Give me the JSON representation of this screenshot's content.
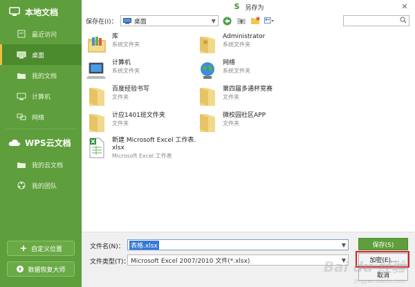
{
  "dialog": {
    "title": "另存为"
  },
  "sidebar": {
    "local_header": "本地文档",
    "local_items": [
      {
        "label": "最近访问",
        "icon": "clock-icon"
      },
      {
        "label": "桌面",
        "icon": "desktop-icon"
      },
      {
        "label": "我的文档",
        "icon": "folder-icon"
      },
      {
        "label": "计算机",
        "icon": "computer-icon"
      },
      {
        "label": "网络",
        "icon": "network-icon"
      }
    ],
    "cloud_header": "WPS云文档",
    "cloud_items": [
      {
        "label": "我的云文档",
        "icon": "cloud-folder-icon"
      },
      {
        "label": "我的团队",
        "icon": "team-icon"
      }
    ],
    "custom_location": "自定义位置",
    "recovery": "数据恢复大师"
  },
  "toolbar": {
    "save_in_label": "保存在(I)：",
    "location": "桌面"
  },
  "files": [
    {
      "name": "库",
      "type": "系统文件夹",
      "icon": "library-folder-icon"
    },
    {
      "name": "Administrator",
      "type": "系统文件夹",
      "icon": "user-folder-icon"
    },
    {
      "name": "计算机",
      "type": "系统文件夹",
      "icon": "computer-icon"
    },
    {
      "name": "网络",
      "type": "系统文件夹",
      "icon": "network-globe-icon"
    },
    {
      "name": "百度经验书写",
      "type": "文件夹",
      "icon": "folder-icon"
    },
    {
      "name": "第四届多通杯竞赛",
      "type": "文件夹",
      "icon": "folder-icon"
    },
    {
      "name": "计应1401班文件夹",
      "type": "文件夹",
      "icon": "folder-icon"
    },
    {
      "name": "微校园社区APP",
      "type": "文件夹",
      "icon": "folder-icon"
    },
    {
      "name": "新建 Microsoft Excel 工作表.",
      "name2": "xlsx",
      "type": "Microsoft Excel 工作表",
      "icon": "excel-file-icon"
    }
  ],
  "bottom": {
    "filename_label": "文件名(N)：",
    "filename_value": "表格.xlsx",
    "filetype_label": "文件类型(T)：",
    "filetype_value": "Microsoft Excel 2007/2010 文件(*.xlsx)",
    "save_label": "保存(S)",
    "encrypt_label": "加密(E)...",
    "cancel_label": "取消"
  },
  "watermark": {
    "logo": "Bai du 经验",
    "url": "jingyan.baidu.com"
  },
  "colors": {
    "sidebar": "#5e9e3c",
    "highlight": "#d0202a",
    "selection": "#3579d6"
  }
}
